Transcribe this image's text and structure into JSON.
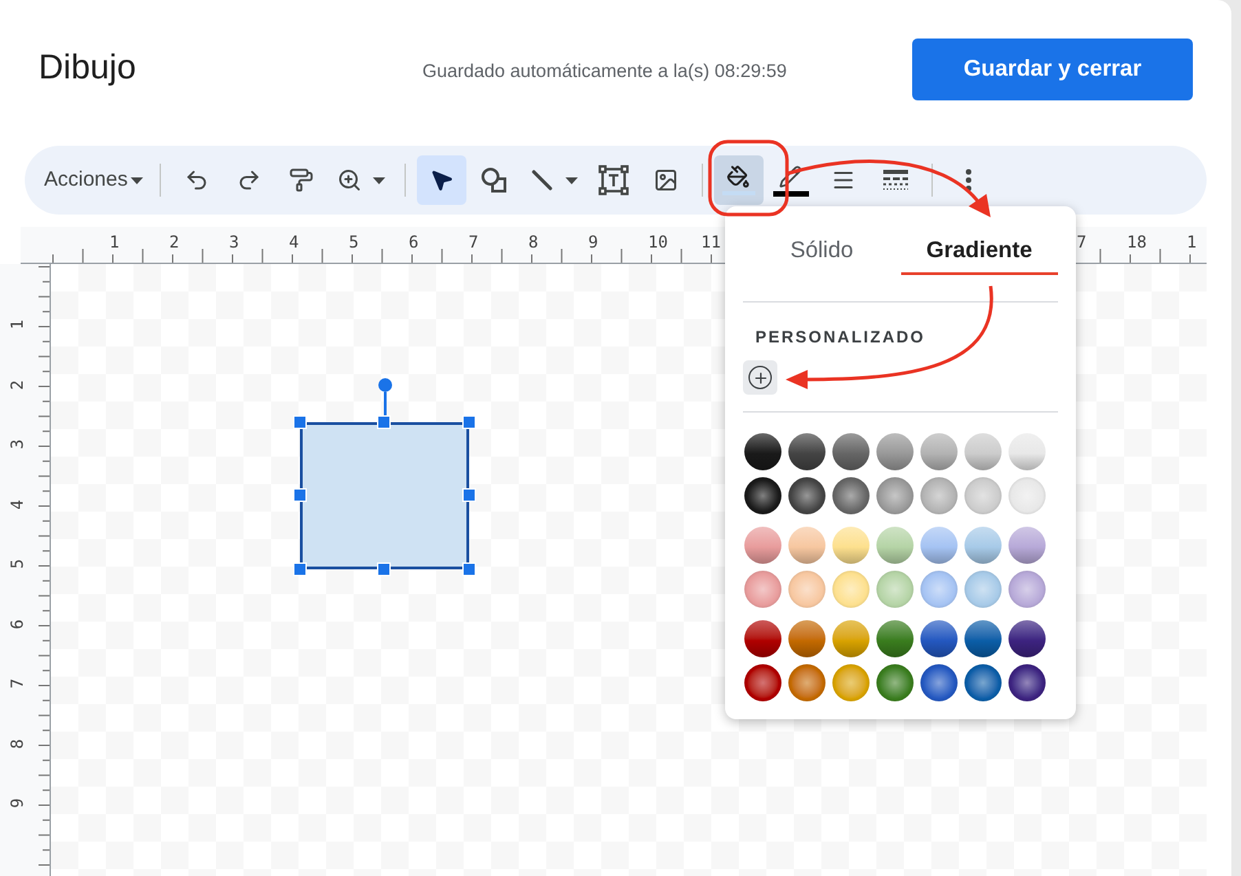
{
  "window": {
    "title": "Dibujo"
  },
  "save_status": "Guardado automáticamente a la(s) 08:29:59",
  "save_button": "Guardar y cerrar",
  "toolbar": {
    "actions_menu": "Acciones",
    "tools": [
      {
        "kind": "undo",
        "selected": false
      },
      {
        "kind": "redo",
        "selected": false
      },
      {
        "kind": "paint-format",
        "selected": false
      },
      {
        "kind": "zoom",
        "selected": false
      },
      {
        "kind": "divider"
      },
      {
        "kind": "select",
        "selected": true
      },
      {
        "kind": "shape",
        "selected": false
      },
      {
        "kind": "line",
        "selected": false
      },
      {
        "kind": "text-box",
        "selected": false
      },
      {
        "kind": "image",
        "selected": false
      },
      {
        "kind": "divider"
      },
      {
        "kind": "fill",
        "selected": true
      },
      {
        "kind": "pen",
        "selected": false
      },
      {
        "kind": "line-weight",
        "selected": false
      },
      {
        "kind": "line-dash",
        "selected": false
      },
      {
        "kind": "divider"
      },
      {
        "kind": "more",
        "selected": false
      }
    ]
  },
  "horizontal_ruler": [
    "1",
    "2",
    "3",
    "4",
    "5",
    "6",
    "7",
    "8",
    "9",
    "10",
    "11",
    "7",
    "18",
    "1"
  ],
  "vertical_ruler": [
    "1",
    "2",
    "3",
    "4",
    "5",
    "6",
    "7",
    "8",
    "9"
  ],
  "fill_popover": {
    "tabs": [
      {
        "label": "Sólido",
        "selected": false
      },
      {
        "label": "Gradiente",
        "selected": true
      }
    ],
    "custom_heading": "PERSONALIZADO",
    "swatch_rows": [
      {
        "kind": "linear",
        "swatches": [
          {
            "color": "#1a1a1a"
          },
          {
            "color": "#444444"
          },
          {
            "color": "#666666"
          },
          {
            "color": "#999999"
          },
          {
            "color": "#b3b3b3"
          },
          {
            "color": "#cccccc"
          },
          {
            "color": "#e8e8e8"
          }
        ]
      },
      {
        "kind": "radial",
        "swatches": [
          {
            "color": "#1a1a1a"
          },
          {
            "color": "#444444"
          },
          {
            "color": "#666666"
          },
          {
            "color": "#999999"
          },
          {
            "color": "#b3b3b3"
          },
          {
            "color": "#cccccc"
          },
          {
            "color": "#e8e8e8"
          }
        ]
      },
      {
        "kind": "linear",
        "swatches": [
          {
            "color": "#e89c9c"
          },
          {
            "color": "#f7c7a0"
          },
          {
            "color": "#fde08e"
          },
          {
            "color": "#b5d4a6"
          },
          {
            "color": "#a5c3f3"
          },
          {
            "color": "#a7cae8"
          },
          {
            "color": "#b7a9d8"
          }
        ]
      },
      {
        "kind": "radial",
        "swatches": [
          {
            "color": "#e89c9c"
          },
          {
            "color": "#f7c7a0"
          },
          {
            "color": "#fde08e"
          },
          {
            "color": "#b5d4a6"
          },
          {
            "color": "#a5c3f3"
          },
          {
            "color": "#a7cae8"
          },
          {
            "color": "#b7a9d8"
          }
        ]
      },
      {
        "kind": "linear",
        "swatches": [
          {
            "color": "#b00000"
          },
          {
            "color": "#c46a00"
          },
          {
            "color": "#d9a300"
          },
          {
            "color": "#3a7d1e"
          },
          {
            "color": "#2458c0"
          },
          {
            "color": "#0b5ea8"
          },
          {
            "color": "#3d2380"
          }
        ]
      },
      {
        "kind": "radial",
        "swatches": [
          {
            "color": "#b00000"
          },
          {
            "color": "#c46a00"
          },
          {
            "color": "#d9a300"
          },
          {
            "color": "#3a7d1e"
          },
          {
            "color": "#2458c0"
          },
          {
            "color": "#0b5ea8"
          },
          {
            "color": "#3d2380"
          }
        ]
      }
    ]
  },
  "annotations": [
    {
      "kind": "highlight"
    },
    {
      "kind": "arrow"
    },
    {
      "kind": "arrow"
    }
  ]
}
